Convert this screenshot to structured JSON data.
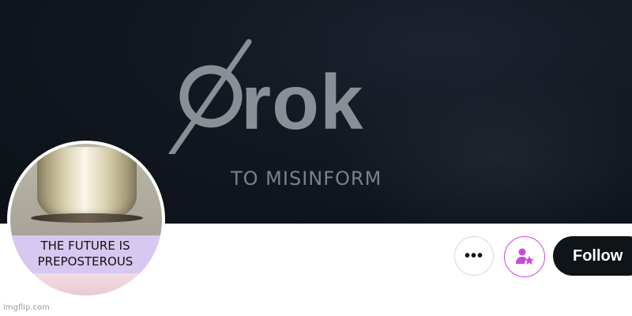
{
  "banner": {
    "logo_text": "rok",
    "tagline": "TO MISINFORM"
  },
  "avatar": {
    "caption": "THE FUTURE IS PREPOSTEROUS"
  },
  "actions": {
    "more_label": "•••",
    "subscribe_icon": "person-star-icon",
    "follow_label": "Follow"
  },
  "watermark": "imgflip.com",
  "colors": {
    "banner_bg": "#121820",
    "logo_gray": "#8a8f96",
    "follow_bg": "#0f1419",
    "subscribe_accent": "#c94ad8",
    "caption_bg": "#d6c8f0"
  }
}
